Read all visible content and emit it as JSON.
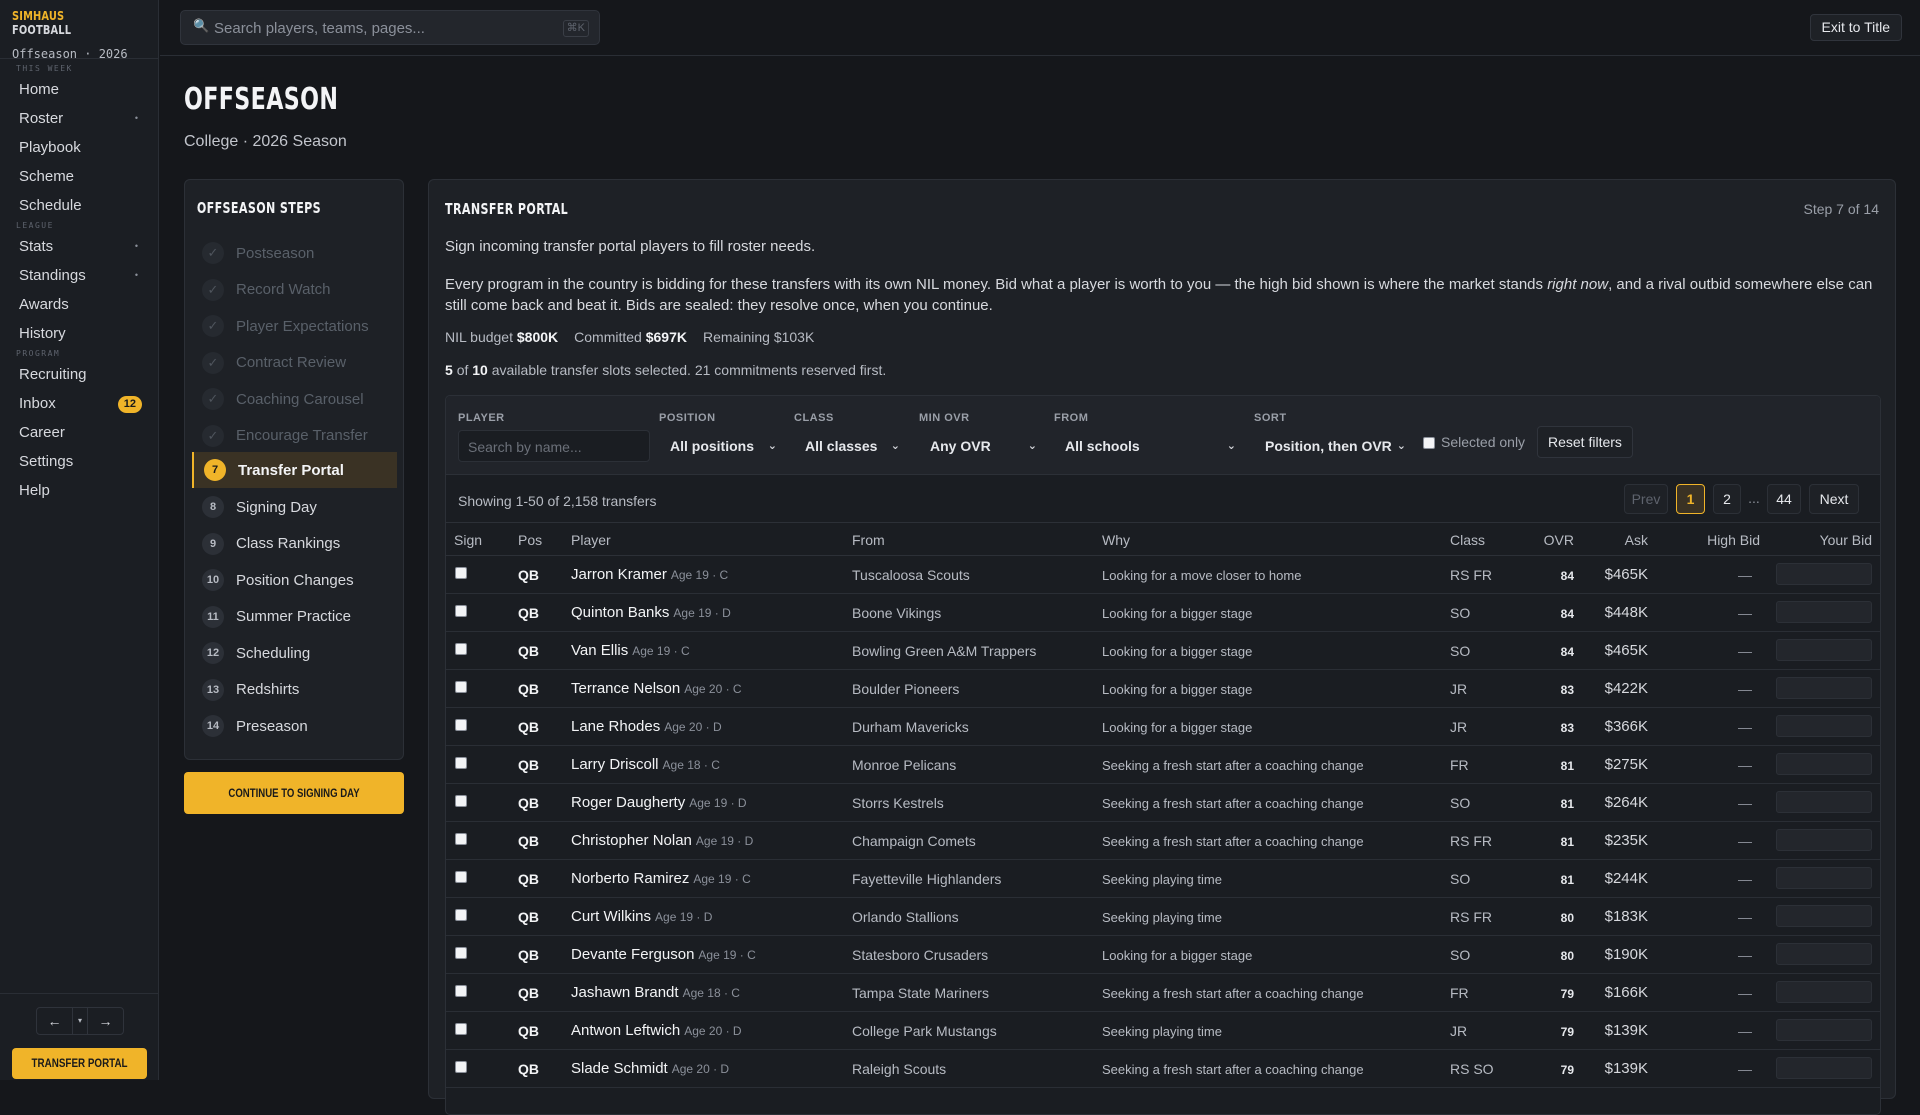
{
  "app": {
    "brand_a": "SIMHAUS",
    "brand_b": "FOOTBALL",
    "subtitle": "Offseason · 2026"
  },
  "sidebar": {
    "sections": [
      {
        "label": "THIS WEEK",
        "items": [
          {
            "label": "Home"
          },
          {
            "label": "Roster",
            "dot": "•"
          },
          {
            "label": "Playbook"
          },
          {
            "label": "Scheme"
          },
          {
            "label": "Schedule"
          }
        ]
      },
      {
        "label": "LEAGUE",
        "items": [
          {
            "label": "Stats",
            "dot": "•"
          },
          {
            "label": "Standings",
            "dot": "•"
          },
          {
            "label": "Awards"
          },
          {
            "label": "History"
          }
        ]
      },
      {
        "label": "PROGRAM",
        "items": [
          {
            "label": "Recruiting"
          },
          {
            "label": "Inbox",
            "badge": "12"
          },
          {
            "label": "Career"
          },
          {
            "label": "Settings"
          },
          {
            "label": "Help"
          }
        ]
      }
    ],
    "back_icon": "←",
    "menu_icon": "▾",
    "forward_icon": "→",
    "footer_button": "TRANSFER PORTAL"
  },
  "search": {
    "placeholder": "Search players, teams, pages...",
    "shortcut": "⌘K"
  },
  "topbar": {
    "exit_label": "Exit to Title"
  },
  "page": {
    "title": "OFFSEASON",
    "subtitle": "College · 2026 Season"
  },
  "steps": {
    "title": "OFFSEASON STEPS",
    "items": [
      {
        "n": "✓",
        "label": "Postseason",
        "state": "done"
      },
      {
        "n": "✓",
        "label": "Record Watch",
        "state": "done"
      },
      {
        "n": "✓",
        "label": "Player Expectations",
        "state": "done"
      },
      {
        "n": "✓",
        "label": "Contract Review",
        "state": "done"
      },
      {
        "n": "✓",
        "label": "Coaching Carousel",
        "state": "done"
      },
      {
        "n": "✓",
        "label": "Encourage Transfer",
        "state": "done"
      },
      {
        "n": "7",
        "label": "Transfer Portal",
        "state": "current"
      },
      {
        "n": "8",
        "label": "Signing Day",
        "state": "todo"
      },
      {
        "n": "9",
        "label": "Class Rankings",
        "state": "todo"
      },
      {
        "n": "10",
        "label": "Position Changes",
        "state": "todo"
      },
      {
        "n": "11",
        "label": "Summer Practice",
        "state": "todo"
      },
      {
        "n": "12",
        "label": "Scheduling",
        "state": "todo"
      },
      {
        "n": "13",
        "label": "Redshirts",
        "state": "todo"
      },
      {
        "n": "14",
        "label": "Preseason",
        "state": "todo"
      }
    ],
    "continue_label": "CONTINUE TO SIGNING DAY"
  },
  "portal": {
    "title": "TRANSFER PORTAL",
    "step_of": "Step 7 of 14",
    "intro": "Sign incoming transfer portal players to fill roster needs.",
    "desc_a": "Every program in the country is bidding for these transfers with its own NIL money. Bid what a player is worth to you — the high bid shown is where the market stands ",
    "desc_em": "right now",
    "desc_b": ", and a rival outbid somewhere else can still come back and beat it. Bids are sealed: they resolve once, when you continue.",
    "budget": {
      "budget_label": "NIL budget",
      "budget": "$800K",
      "committed_label": "Committed",
      "committed": "$697K",
      "remaining_label": "Remaining",
      "remaining": "$103K"
    },
    "slots": {
      "selected": "5",
      "of": "of",
      "total": "10",
      "rest": "available transfer slots selected. 21 commitments reserved first."
    },
    "filters": {
      "player_label": "PLAYER",
      "player_placeholder": "Search by name...",
      "position_label": "POSITION",
      "position_value": "All positions",
      "class_label": "CLASS",
      "class_value": "All classes",
      "minovr_label": "MIN OVR",
      "minovr_value": "Any OVR",
      "from_label": "FROM",
      "from_value": "All schools",
      "sort_label": "SORT",
      "sort_value": "Position, then OVR",
      "selected_only": "Selected only",
      "reset": "Reset filters"
    },
    "showing": "Showing 1-50 of 2,158 transfers",
    "pagination": {
      "prev": "Prev",
      "p1": "1",
      "p2": "2",
      "ellipsis": "...",
      "last": "44",
      "next": "Next"
    },
    "columns": {
      "sign": "Sign",
      "pos": "Pos",
      "player": "Player",
      "from": "From",
      "why": "Why",
      "class": "Class",
      "ovr": "OVR",
      "ask": "Ask",
      "high_bid": "High Bid",
      "your_bid": "Your Bid"
    },
    "rows": [
      {
        "pos": "QB",
        "name": "Jarron Kramer",
        "meta": "Age 19 · C",
        "from": "Tuscaloosa Scouts",
        "why": "Looking for a move closer to home",
        "cls": "RS FR",
        "ovr": "84",
        "ask": "$465K",
        "high": "—"
      },
      {
        "pos": "QB",
        "name": "Quinton Banks",
        "meta": "Age 19 · D",
        "from": "Boone Vikings",
        "why": "Looking for a bigger stage",
        "cls": "SO",
        "ovr": "84",
        "ask": "$448K",
        "high": "—"
      },
      {
        "pos": "QB",
        "name": "Van Ellis",
        "meta": "Age 19 · C",
        "from": "Bowling Green A&M Trappers",
        "why": "Looking for a bigger stage",
        "cls": "SO",
        "ovr": "84",
        "ask": "$465K",
        "high": "—"
      },
      {
        "pos": "QB",
        "name": "Terrance Nelson",
        "meta": "Age 20 · C",
        "from": "Boulder Pioneers",
        "why": "Looking for a bigger stage",
        "cls": "JR",
        "ovr": "83",
        "ask": "$422K",
        "high": "—"
      },
      {
        "pos": "QB",
        "name": "Lane Rhodes",
        "meta": "Age 20 · D",
        "from": "Durham Mavericks",
        "why": "Looking for a bigger stage",
        "cls": "JR",
        "ovr": "83",
        "ask": "$366K",
        "high": "—"
      },
      {
        "pos": "QB",
        "name": "Larry Driscoll",
        "meta": "Age 18 · C",
        "from": "Monroe Pelicans",
        "why": "Seeking a fresh start after a coaching change",
        "cls": "FR",
        "ovr": "81",
        "ask": "$275K",
        "high": "—"
      },
      {
        "pos": "QB",
        "name": "Roger Daugherty",
        "meta": "Age 19 · D",
        "from": "Storrs Kestrels",
        "why": "Seeking a fresh start after a coaching change",
        "cls": "SO",
        "ovr": "81",
        "ask": "$264K",
        "high": "—"
      },
      {
        "pos": "QB",
        "name": "Christopher Nolan",
        "meta": "Age 19 · D",
        "from": "Champaign Comets",
        "why": "Seeking a fresh start after a coaching change",
        "cls": "RS FR",
        "ovr": "81",
        "ask": "$235K",
        "high": "—"
      },
      {
        "pos": "QB",
        "name": "Norberto Ramirez",
        "meta": "Age 19 · C",
        "from": "Fayetteville Highlanders",
        "why": "Seeking playing time",
        "cls": "SO",
        "ovr": "81",
        "ask": "$244K",
        "high": "—"
      },
      {
        "pos": "QB",
        "name": "Curt Wilkins",
        "meta": "Age 19 · D",
        "from": "Orlando Stallions",
        "why": "Seeking playing time",
        "cls": "RS FR",
        "ovr": "80",
        "ask": "$183K",
        "high": "—"
      },
      {
        "pos": "QB",
        "name": "Devante Ferguson",
        "meta": "Age 19 · C",
        "from": "Statesboro Crusaders",
        "why": "Looking for a bigger stage",
        "cls": "SO",
        "ovr": "80",
        "ask": "$190K",
        "high": "—"
      },
      {
        "pos": "QB",
        "name": "Jashawn Brandt",
        "meta": "Age 18 · C",
        "from": "Tampa State Mariners",
        "why": "Seeking a fresh start after a coaching change",
        "cls": "FR",
        "ovr": "79",
        "ask": "$166K",
        "high": "—"
      },
      {
        "pos": "QB",
        "name": "Antwon Leftwich",
        "meta": "Age 20 · D",
        "from": "College Park Mustangs",
        "why": "Seeking playing time",
        "cls": "JR",
        "ovr": "79",
        "ask": "$139K",
        "high": "—"
      },
      {
        "pos": "QB",
        "name": "Slade Schmidt",
        "meta": "Age 20 · D",
        "from": "Raleigh Scouts",
        "why": "Seeking a fresh start after a coaching change",
        "cls": "RS SO",
        "ovr": "79",
        "ask": "$139K",
        "high": "—"
      }
    ]
  },
  "colors": {
    "accent": "#f0b429",
    "background": "#15171b",
    "panel": "#1e2126"
  }
}
